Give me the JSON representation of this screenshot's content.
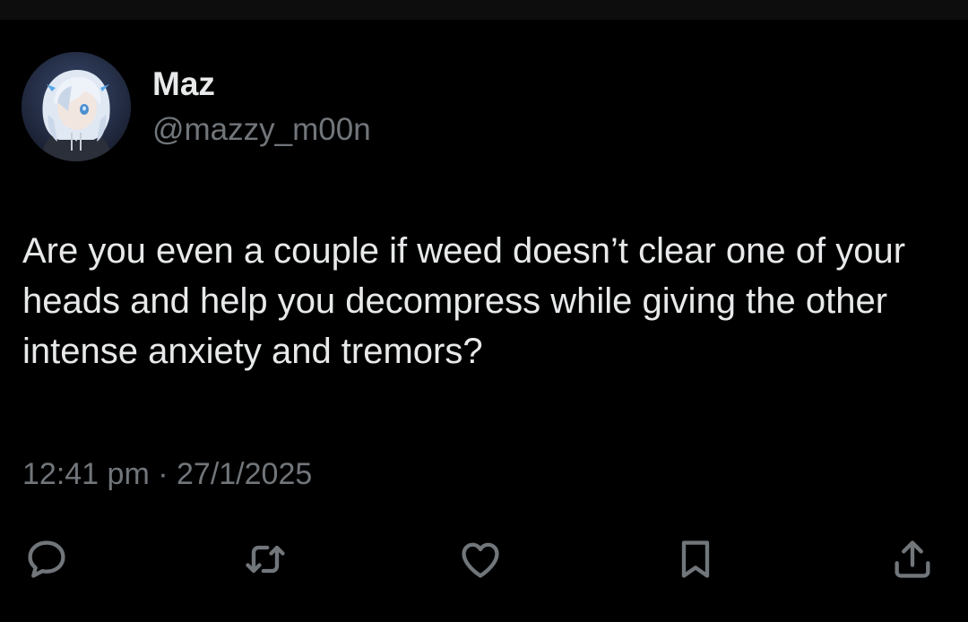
{
  "author": {
    "display_name": "Maz",
    "handle": "@mazzy_m00n",
    "avatar_icon": "anime-avatar"
  },
  "tweet": {
    "text": "Are you even a couple if weed doesn’t clear one of your heads and help you decompress while giving the other intense anxiety and tremors?",
    "time": "12:41 pm",
    "separator": "·",
    "date": "27/1/2025"
  },
  "actions": [
    {
      "name": "reply",
      "icon": "speech-bubble-icon"
    },
    {
      "name": "retweet",
      "icon": "retweet-icon"
    },
    {
      "name": "like",
      "icon": "heart-icon"
    },
    {
      "name": "bookmark",
      "icon": "bookmark-icon"
    },
    {
      "name": "share",
      "icon": "share-icon"
    }
  ],
  "colors": {
    "background": "#000000",
    "text": "#e7e9ea",
    "secondary": "#71767b"
  }
}
